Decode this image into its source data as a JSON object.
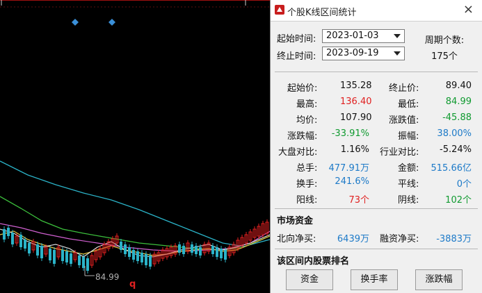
{
  "chart": {
    "low_label": "84.99",
    "low_marker": "q"
  },
  "panel": {
    "title": "个股K线区间统计",
    "close_glyph": "×",
    "start_label": "起始时间:",
    "start_value": "2023-01-03",
    "end_label": "终止时间:",
    "end_value": "2023-09-19",
    "period_label": "周期个数:",
    "period_value": "175个"
  },
  "stats": {
    "start_price_label": "起始价:",
    "start_price": "135.28",
    "end_price_label": "终止价:",
    "end_price": "89.40",
    "high_label": "最高:",
    "high": "136.40",
    "low_label": "最低:",
    "low": "84.99",
    "avg_label": "均价:",
    "avg": "107.90",
    "change_value_label": "涨跌值:",
    "change_value": "-45.88",
    "change_pct_label": "涨跌幅:",
    "change_pct": "-33.91%",
    "amplitude_label": "振幅:",
    "amplitude": "38.00%",
    "vs_market_label": "大盘对比:",
    "vs_market": "1.16%",
    "vs_industry_label": "行业对比:",
    "vs_industry": "-5.24%",
    "volume_label": "总手:",
    "volume": "477.91万",
    "amount_label": "金额:",
    "amount": "515.66亿",
    "turnover_label": "换手:",
    "turnover": "241.6%",
    "flat_label": "平线:",
    "flat": "0个",
    "up_label": "阳线:",
    "up": "73个",
    "down_label": "阴线:",
    "down": "102个"
  },
  "funds": {
    "header": "市场资金",
    "north_label": "北向净买:",
    "north": "6439万",
    "margin_label": "融资净买:",
    "margin": "-3883万"
  },
  "ranking": {
    "header": "该区间内股票排名",
    "btn_funds": "资金",
    "btn_turnover": "换手率",
    "btn_change": "涨跌幅"
  },
  "colors": {
    "up": "#e02020",
    "down": "#109a30",
    "neutral": "#1d7ac8",
    "ma_cyan": "#2bb3c8",
    "ma_green": "#3cbf3c",
    "ma_magenta": "#d060d0",
    "ma_yellow": "#e6c640",
    "ma_white": "#e8e8e8"
  }
}
